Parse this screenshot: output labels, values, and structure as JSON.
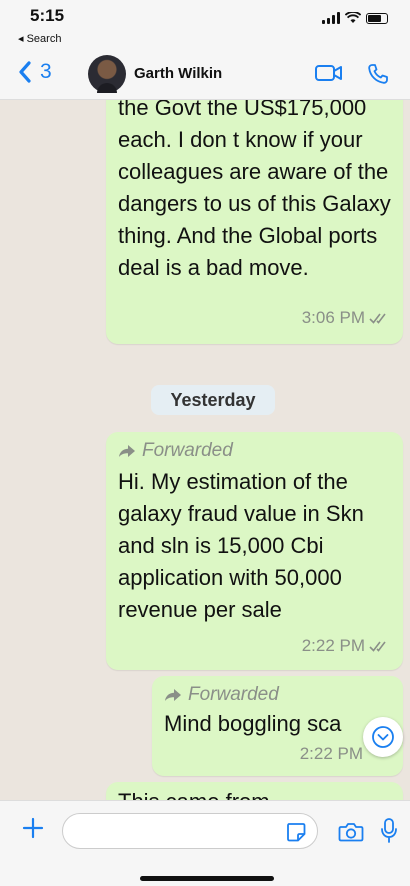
{
  "status_bar": {
    "time": "5:15",
    "back_app": "◂ Search"
  },
  "header": {
    "back_count": "3",
    "contact_name": "Garth Wilkin"
  },
  "messages": [
    {
      "text": "the Govt the US$175,000 each.   I don t know if your colleagues are aware of the dangers to us of this Galaxy thing.  And the Global ports deal is a bad move.",
      "time": "3:06 PM"
    },
    {
      "date_separator": "Yesterday"
    },
    {
      "forwarded_label": "Forwarded",
      "text": "Hi. My estimation of the galaxy fraud value in Skn and sln is 15,000 Cbi application with 50,000 revenue per sale",
      "time": "2:22 PM"
    },
    {
      "forwarded_label": "Forwarded",
      "text": "Mind boggling sca",
      "time": "2:22 PM"
    },
    {
      "text": "This came from"
    }
  ],
  "colors": {
    "accent": "#1a7ff0",
    "bubble_out": "#dcf7c5",
    "chat_bg": "#ebe5de"
  },
  "icons": [
    "chevron-left-icon",
    "video-call-icon",
    "phone-icon",
    "double-check-icon",
    "forward-arrow-icon",
    "scroll-down-icon",
    "plus-icon",
    "sticker-icon",
    "camera-icon",
    "microphone-icon"
  ]
}
